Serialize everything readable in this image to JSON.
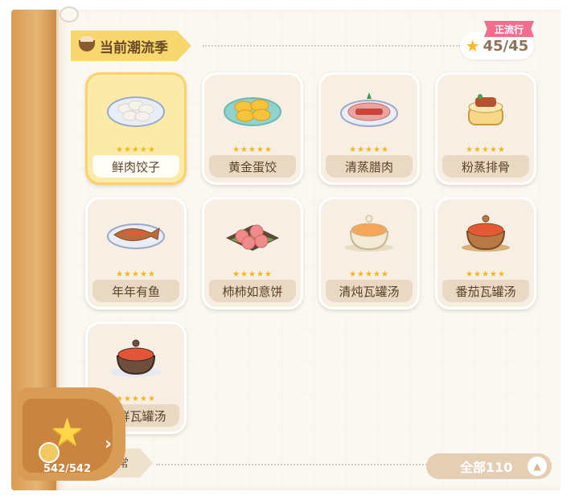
{
  "header": {
    "season_title": "当前潮流季",
    "popular_badge": "正流行",
    "star_count": "45/45"
  },
  "dishes": [
    {
      "name": "鲜肉饺子",
      "stars": "★★★★★",
      "selected": true
    },
    {
      "name": "黄金蛋饺",
      "stars": "★★★★★"
    },
    {
      "name": "清蒸腊肉",
      "stars": "★★★★★"
    },
    {
      "name": "粉蒸排骨",
      "stars": "★★★★★"
    },
    {
      "name": "年年有鱼",
      "stars": "★★★★★"
    },
    {
      "name": "柿柿如意饼",
      "stars": "★★★★★"
    },
    {
      "name": "清炖瓦罐汤",
      "stars": "★★★★★"
    },
    {
      "name": "番茄瓦罐汤",
      "stars": "★★★★★"
    },
    {
      "name": "海鲜瓦罐汤",
      "stars": "★★★★★"
    }
  ],
  "level": {
    "count": "542/542",
    "chevron": "›"
  },
  "section2": {
    "label": "常"
  },
  "footer": {
    "all_label": "全部110",
    "collapse_icon": "▲"
  },
  "colors": {
    "accent_yellow": "#f8d76e",
    "badge_pink": "#ef6f8c",
    "card_bg": "#f7efe3",
    "selected_card_bg": "#fbeaa8",
    "star_gold": "#f1b61c"
  }
}
